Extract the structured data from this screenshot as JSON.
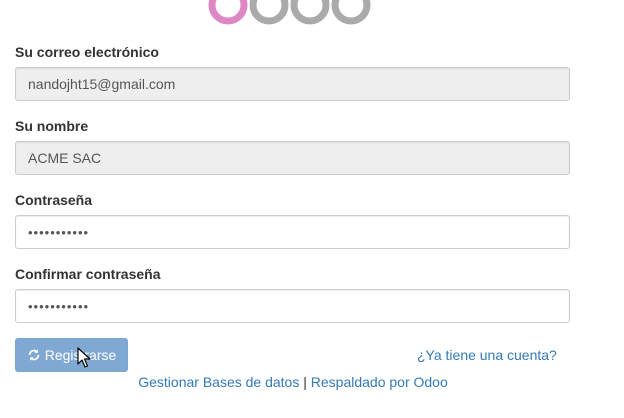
{
  "form": {
    "email_label": "Su correo electrónico",
    "email_value": "nandojht15@gmail.com",
    "name_label": "Su nombre",
    "name_value": "ACME SAC",
    "password_label": "Contraseña",
    "password_value": "•••••••••••",
    "confirm_label": "Confirmar contraseña",
    "confirm_value": "•••••••••••",
    "register_button": "Registrarse",
    "login_link": "¿Ya tiene una cuenta?"
  },
  "footer": {
    "manage_db": "Gestionar Bases de datos",
    "separator": " | ",
    "powered_by": "Respaldado por Odoo"
  },
  "colors": {
    "logo_primary": "#dd88c4",
    "logo_secondary": "#aaaaaa",
    "button_bg": "#7fa9d3",
    "link": "#337ab7"
  },
  "icons": {
    "register": "refresh-icon"
  }
}
